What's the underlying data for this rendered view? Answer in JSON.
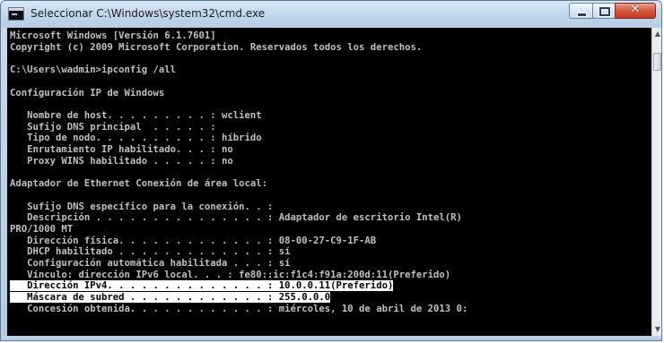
{
  "window": {
    "title": "Seleccionar C:\\Windows\\system32\\cmd.exe",
    "icon": "cmd-icon",
    "controls": {
      "minimize": "minimize-icon",
      "maximize": "maximize-icon",
      "close": "✕"
    }
  },
  "console": {
    "text_color": "#c0c0c0",
    "background": "#000000",
    "lines": [
      {
        "text": "Microsoft Windows [Versión 6.1.7601]"
      },
      {
        "text": "Copyright (c) 2009 Microsoft Corporation. Reservados todos los derechos."
      },
      {
        "text": ""
      },
      {
        "text": "C:\\Users\\wadmin>ipconfig /all"
      },
      {
        "text": ""
      },
      {
        "text": "Configuración IP de Windows"
      },
      {
        "text": ""
      },
      {
        "text": "   Nombre de host. . . . . . . . . : wclient"
      },
      {
        "text": "   Sufijo DNS principal  . . . . . :"
      },
      {
        "text": "   Tipo de nodo. . . . . . . . . . : híbrido"
      },
      {
        "text": "   Enrutamiento IP habilitado. . . : no"
      },
      {
        "text": "   Proxy WINS habilitado . . . . . : no"
      },
      {
        "text": ""
      },
      {
        "text": "Adaptador de Ethernet Conexión de área local:"
      },
      {
        "text": ""
      },
      {
        "text": "   Sufijo DNS específico para la conexión. . :"
      },
      {
        "text": "   Descripción . . . . . . . . . . . . . . . : Adaptador de escritorio Intel(R)"
      },
      {
        "text": "PRO/1000 MT"
      },
      {
        "text": "   Dirección física. . . . . . . . . . . . . : 08-00-27-C9-1F-AB"
      },
      {
        "text": "   DHCP habilitado . . . . . . . . . . . . . : sí"
      },
      {
        "text": "   Configuración automática habilitada . . . : sí"
      },
      {
        "text": "   Vínculo: dirección IPv6 local. . . : fe80::ic:f1c4:f91a:200d:11(Preferido)"
      },
      {
        "text": "   Dirección IPv4. . . . . . . . . . . . . . : 10.0.0.11(Preferido)",
        "selected": true
      },
      {
        "text": "   Máscara de subred . . . . . . . . . . . . : 255.0.0.0",
        "selected": true
      },
      {
        "text": "   Concesión obtenida. . . . . . . . . . . . : miércoles, 10 de abril de 2013 0:"
      }
    ]
  },
  "scrollbar": {
    "up": "▲",
    "down": "▼"
  }
}
